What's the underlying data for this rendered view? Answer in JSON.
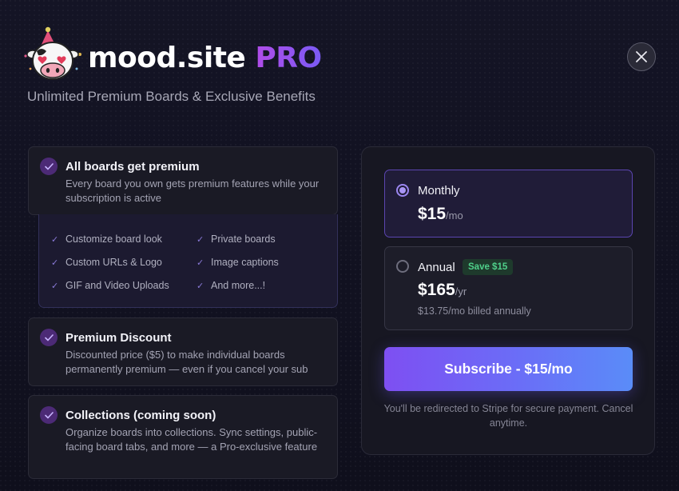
{
  "header": {
    "brand_name": "mood.site",
    "brand_suffix": "PRO",
    "subtitle": "Unlimited Premium Boards & Exclusive Benefits",
    "close_icon": "close-icon"
  },
  "features": [
    {
      "title": "All boards get premium",
      "description": "Every board you own gets premium features while your subscription is active"
    },
    {
      "title": "Premium Discount",
      "description": "Discounted price ($5) to make individual boards permanently premium — even if you cancel your sub"
    },
    {
      "title": "Collections (coming soon)",
      "description": "Organize boards into collections. Sync settings, public-facing board tabs, and more — a Pro-exclusive feature"
    }
  ],
  "sub_features": [
    "Customize board look",
    "Private boards",
    "Custom URLs & Logo",
    "Image captions",
    "GIF and Video Uploads",
    "And more...!"
  ],
  "plans": {
    "monthly": {
      "name": "Monthly",
      "price": "$15",
      "unit": "/mo",
      "selected": true
    },
    "annual": {
      "name": "Annual",
      "badge": "Save $15",
      "price": "$165",
      "unit": "/yr",
      "note": "$13.75/mo billed annually",
      "selected": false
    }
  },
  "subscribe": {
    "label": "Subscribe - $15/mo",
    "note": "You'll be redirected to Stripe for secure payment. Cancel anytime."
  },
  "colors": {
    "accent_purple": "#7e4ff2",
    "accent_blue": "#5a8cf8",
    "save_green": "#4fd08a",
    "background": "#131322"
  }
}
